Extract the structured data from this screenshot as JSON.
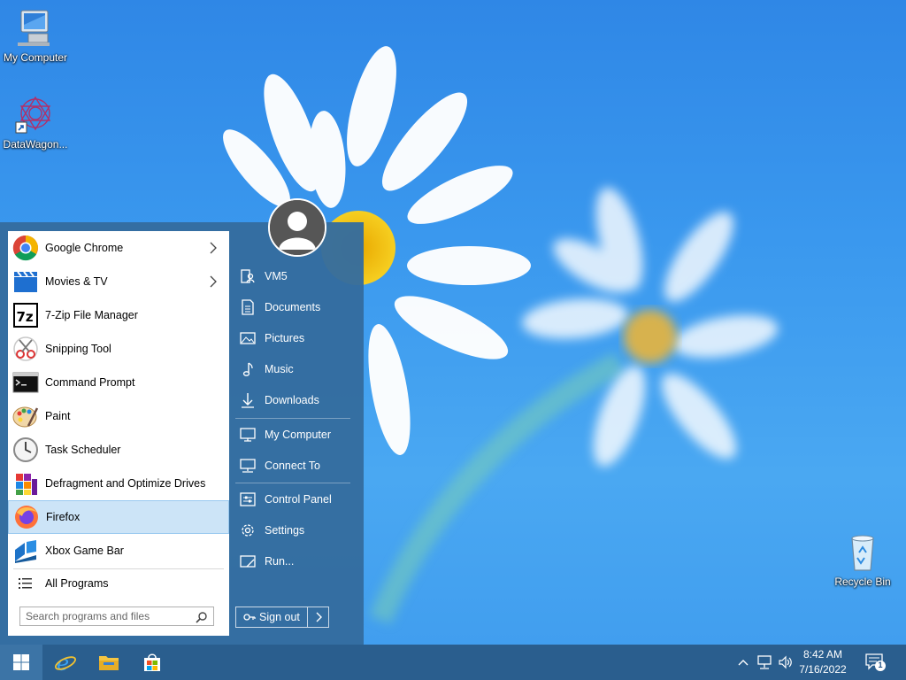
{
  "desktop": {
    "icons": [
      {
        "name": "my-computer",
        "label": "My Computer"
      },
      {
        "name": "datawagon",
        "label": "DataWagon..."
      },
      {
        "name": "recycle-bin",
        "label": "Recycle Bin"
      }
    ]
  },
  "start_menu": {
    "programs": [
      {
        "label": "Google Chrome",
        "icon": "chrome-icon",
        "has_submenu": true
      },
      {
        "label": "Movies & TV",
        "icon": "movies-tv-icon",
        "has_submenu": true
      },
      {
        "label": "7-Zip File Manager",
        "icon": "7zip-icon",
        "has_submenu": false
      },
      {
        "label": "Snipping Tool",
        "icon": "snipping-tool-icon",
        "has_submenu": false
      },
      {
        "label": "Command Prompt",
        "icon": "command-prompt-icon",
        "has_submenu": false
      },
      {
        "label": "Paint",
        "icon": "paint-icon",
        "has_submenu": false
      },
      {
        "label": "Task Scheduler",
        "icon": "task-scheduler-icon",
        "has_submenu": false
      },
      {
        "label": "Defragment and Optimize Drives",
        "icon": "defrag-icon",
        "has_submenu": false
      },
      {
        "label": "Firefox",
        "icon": "firefox-icon",
        "has_submenu": false,
        "highlighted": true
      },
      {
        "label": "Xbox Game Bar",
        "icon": "xbox-game-bar-icon",
        "has_submenu": false
      }
    ],
    "all_programs": "All Programs",
    "search_placeholder": "Search programs and files",
    "right_items": [
      {
        "label": "VM5",
        "icon": "user-folder-icon"
      },
      {
        "label": "Documents",
        "icon": "documents-icon"
      },
      {
        "label": "Pictures",
        "icon": "pictures-icon"
      },
      {
        "label": "Music",
        "icon": "music-icon"
      },
      {
        "label": "Downloads",
        "icon": "downloads-icon"
      },
      {
        "label": "My Computer",
        "icon": "computer-icon"
      },
      {
        "label": "Connect To",
        "icon": "connect-to-icon"
      },
      {
        "label": "Control Panel",
        "icon": "control-panel-icon"
      },
      {
        "label": "Settings",
        "icon": "settings-icon"
      },
      {
        "label": "Run...",
        "icon": "run-icon"
      }
    ],
    "sign_out": "Sign out"
  },
  "taskbar": {
    "pinned": [
      "start-icon",
      "internet-explorer-icon",
      "file-explorer-icon",
      "store-icon"
    ],
    "clock_time": "8:42 AM",
    "clock_date": "7/16/2022",
    "notification_count": "1"
  },
  "colors": {
    "start_menu_bg": "#346c9e",
    "taskbar_bg": "#2a5e8e",
    "highlight": "#cce4f7"
  }
}
